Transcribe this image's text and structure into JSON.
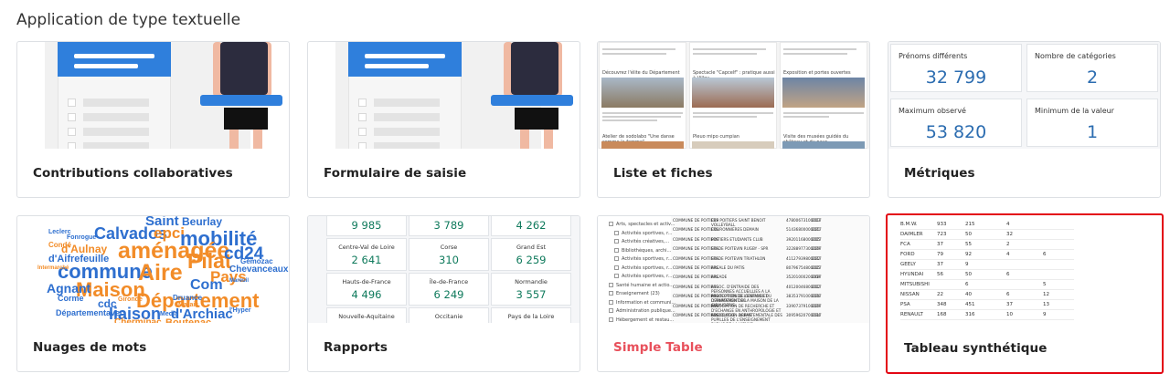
{
  "section_title": "Application de type textuelle",
  "cards": [
    {
      "label": "Contributions collaboratives"
    },
    {
      "label": "Formulaire de saisie"
    },
    {
      "label": "Liste et fiches"
    },
    {
      "label": "Métriques"
    },
    {
      "label": "Nuages de mots"
    },
    {
      "label": "Rapports"
    },
    {
      "label": "Simple Table"
    },
    {
      "label": "Tableau synthétique"
    }
  ],
  "list_thumb": {
    "titles": [
      "Découvrez l'élite du Département",
      "Spectacle \"Capcelf\" : pratique aussi à Villeu...",
      "Exposition et portes ouvertes",
      "Atelier de sodolabo \"Une danse comme la femme\"",
      "Pleuo mipo cumpian",
      "Visite des musées guidés du château et du pays"
    ]
  },
  "metrics": [
    {
      "label": "Prénoms différents",
      "value": "32 799"
    },
    {
      "label": "Nombre de catégories",
      "value": "2"
    },
    {
      "label": "Maximum observé",
      "value": "53 820"
    },
    {
      "label": "Minimum de la valeur",
      "value": "1"
    }
  ],
  "word_cloud": [
    {
      "t": "Saint",
      "c": "#2e6fcf"
    },
    {
      "t": "Beurlay",
      "c": "#2e6fcf"
    },
    {
      "t": "Calvados",
      "c": "#2e6fcf"
    },
    {
      "t": "epci",
      "c": "#f28c28"
    },
    {
      "t": "mobilité",
      "c": "#2e6fcf"
    },
    {
      "t": "aménagée",
      "c": "#f28c28"
    },
    {
      "t": "Pilat",
      "c": "#f28c28"
    },
    {
      "t": "cd24",
      "c": "#2e6fcf"
    },
    {
      "t": "commune",
      "c": "#2e6fcf"
    },
    {
      "t": "Aire",
      "c": "#f28c28"
    },
    {
      "t": "Pays",
      "c": "#f28c28"
    },
    {
      "t": "Maison",
      "c": "#f28c28"
    },
    {
      "t": "Com",
      "c": "#2e6fcf"
    },
    {
      "t": "Département",
      "c": "#f28c28"
    },
    {
      "t": "liaison",
      "c": "#2e6fcf"
    },
    {
      "t": "d'Archiac",
      "c": "#2e6fcf"
    },
    {
      "t": "Agnant",
      "c": "#2e6fcf"
    },
    {
      "t": "d'Aulnay",
      "c": "#f28c28"
    },
    {
      "t": "d'Aifrefeuille",
      "c": "#2e6fcf"
    },
    {
      "t": "Chevanceaux",
      "c": "#2e6fcf"
    },
    {
      "t": "Corme",
      "c": "#2e6fcf"
    },
    {
      "t": "cdc",
      "c": "#2e6fcf"
    },
    {
      "t": "Départementavec",
      "c": "#2e6fcf"
    },
    {
      "t": "Boutenac",
      "c": "#f28c28"
    },
    {
      "t": "Cherminac",
      "c": "#f28c28"
    },
    {
      "t": "Leclerc",
      "c": "#2e6fcf"
    },
    {
      "t": "Condé",
      "c": "#f28c28"
    },
    {
      "t": "Fonrogue",
      "c": "#2e6fcf"
    },
    {
      "t": "Intermarché",
      "c": "#f28c28"
    },
    {
      "t": "Gémozac",
      "c": "#2e6fcf"
    },
    {
      "t": "Druance",
      "c": "#2e6fcf"
    },
    {
      "t": "Marais",
      "c": "#f28c28"
    },
    {
      "t": "Media",
      "c": "#2e6fcf"
    },
    {
      "t": "l'Hyper",
      "c": "#2e6fcf"
    },
    {
      "t": "Gironde",
      "c": "#f28c28"
    },
    {
      "t": "Mareuil",
      "c": "#2e6fcf"
    }
  ],
  "reports": [
    {
      "label": "",
      "value": "9 985"
    },
    {
      "label": "",
      "value": "3 789"
    },
    {
      "label": "",
      "value": "4 262"
    },
    {
      "label": "Centre-Val de Loire",
      "value": "2 641"
    },
    {
      "label": "Corse",
      "value": "310"
    },
    {
      "label": "Grand Est",
      "value": "6 259"
    },
    {
      "label": "Hauts-de-France",
      "value": "4 496"
    },
    {
      "label": "Île-de-France",
      "value": "6 249"
    },
    {
      "label": "Normandie",
      "value": "3 557"
    },
    {
      "label": "Nouvelle-Aquitaine",
      "value": ""
    },
    {
      "label": "Occitanie",
      "value": ""
    },
    {
      "label": "Pays de la Loire",
      "value": ""
    }
  ],
  "simple_table": {
    "tree": [
      "Arts, spectacles et activ...",
      "Activités sportives, r...",
      "Activités créatives,...",
      "Bibliothèques, archi...",
      "Activités sportives, r...",
      "Activités sportives, r...",
      "Activités sportives, r...",
      "Santé humaine et actio...",
      "Enseignement (23)",
      "Information et communi...",
      "Administration publique...",
      "Hébergement et restau..."
    ],
    "rows": [
      [
        "COMMUNE DE POITIERS",
        "CEP POITIERS SAINT BENOIT VOLLEYBALL",
        "47800673100013",
        "2017"
      ],
      [
        "COMMUNE DE POITIERS",
        "COURONNIERES DEMAIN",
        "51436800000021",
        "2017"
      ],
      [
        "COMMUNE DE POITIERS",
        "POITIERS ETUDIANTS CLUB",
        "39201168000015",
        "2017"
      ],
      [
        "COMMUNE DE POITIERS",
        "STADE POITEVIN RUGBY - SPR",
        "32288977300029",
        "2017"
      ],
      [
        "COMMUNE DE POITIERS",
        "STADE POITEVIN TRIATHLON",
        "41127939800022",
        "2017"
      ],
      [
        "COMMUNE DE POITIERS",
        "ARCALE DU PATIS",
        "80796754800015",
        "2017"
      ],
      [
        "COMMUNE DE POITIERS",
        "ARCADE",
        "35201000200069",
        "2017"
      ],
      [
        "COMMUNE DE POITIERS",
        "ASSOC. D'ENTRAIDE DES PERSONNES ACCUEILLIES A LA PROTECTION DE L'ENFANCE DU DEPARTEMENT 86",
        "40120046800012",
        "2017"
      ],
      [
        "COMMUNE DE POITIERS",
        "ASSOCIATION DE GESTION ET D'ANIMATION DE LA MAISON DE LA GIBAUDERIE",
        "38353791000026",
        "2017"
      ],
      [
        "COMMUNE DE POITIERS",
        "ASSOCIATION DE RECHERCHE ET D'ECHANGE EN ANTHROPOLOGIE ET SOCIOLOGIE - AREAS",
        "33907379100029",
        "2017"
      ],
      [
        "COMMUNE DE POITIERS",
        "ASSOCIATION DEPARTEMENTALE DES PUPILLES DE L'ENSEIGNEMENT PUBLIC DE LA VIENNE",
        "30959620700034",
        "2017"
      ]
    ]
  },
  "synthetic_table": {
    "rows": [
      [
        "B.M.W.",
        "933",
        "215",
        "4",
        ""
      ],
      [
        "DAIMLER",
        "723",
        "50",
        "32",
        ""
      ],
      [
        "FCA",
        "37",
        "55",
        "2",
        ""
      ],
      [
        "FORD",
        "79",
        "92",
        "4",
        "6"
      ],
      [
        "GEELY",
        "37",
        "9",
        "",
        ""
      ],
      [
        "HYUNDAI",
        "56",
        "50",
        "6",
        ""
      ],
      [
        "MITSUBISHI",
        "",
        "6",
        "",
        "5"
      ],
      [
        "NISSAN",
        "22",
        "40",
        "6",
        "12"
      ],
      [
        "PSA",
        "348",
        "451",
        "37",
        "13"
      ],
      [
        "RENAULT",
        "168",
        "316",
        "10",
        "9"
      ]
    ]
  },
  "colors": {
    "accent_blue": "#2f7fdc",
    "selected_border": "#e30613",
    "report_value": "#0f7a5c",
    "metric_value": "#2b6cb0"
  }
}
